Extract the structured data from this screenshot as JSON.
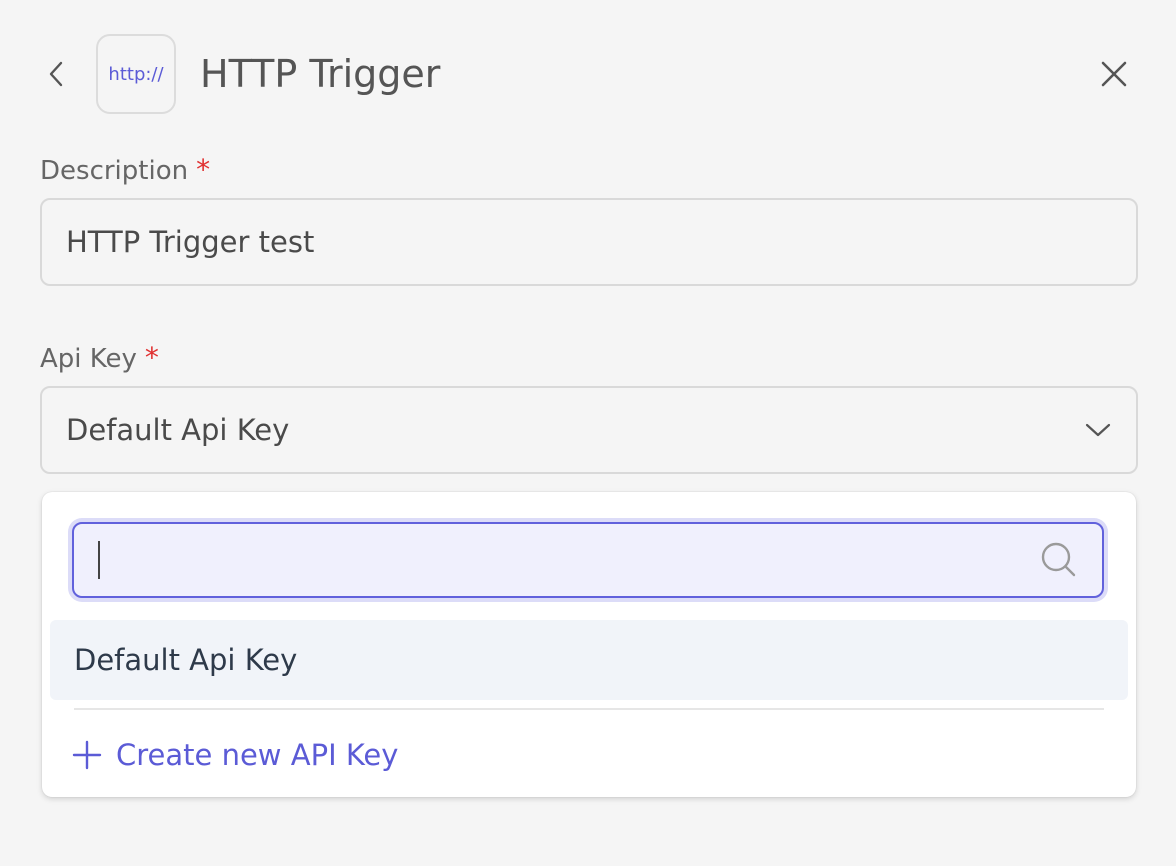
{
  "header": {
    "logo_text": "http://",
    "title": "HTTP Trigger"
  },
  "description": {
    "label": "Description",
    "required_mark": "*",
    "value": "HTTP Trigger test"
  },
  "api_key": {
    "label": "Api Key",
    "required_mark": "*",
    "selected": "Default Api Key"
  },
  "dropdown": {
    "search_value": "",
    "options": [
      {
        "label": "Default Api Key"
      }
    ],
    "create_label": "Create new API Key"
  },
  "icons": {
    "back": "chevron-left-icon",
    "close": "close-icon",
    "select": "chevron-down-icon",
    "search": "search-icon",
    "create": "plus-icon"
  },
  "colors": {
    "accent": "#5b5bd6",
    "required": "#e03131",
    "background": "#f5f5f5"
  }
}
